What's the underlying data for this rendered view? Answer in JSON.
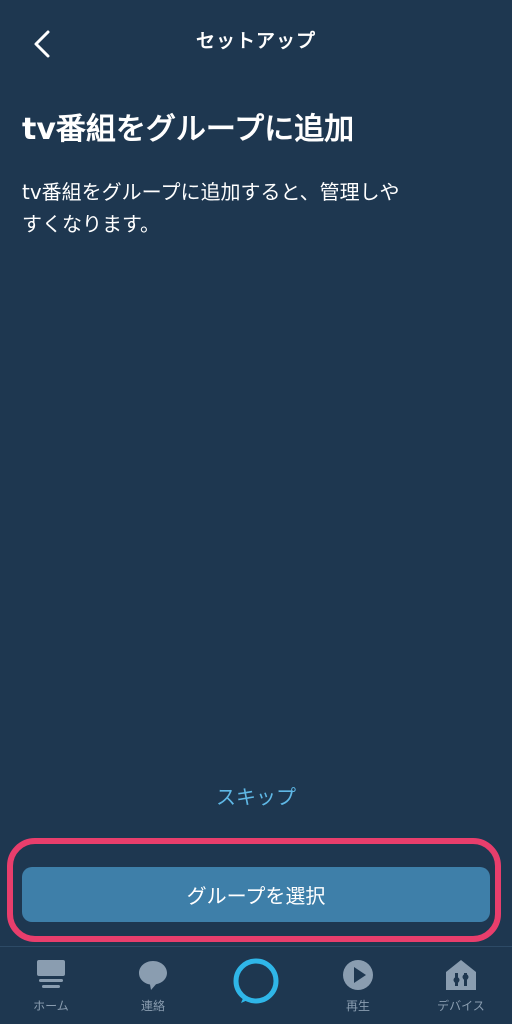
{
  "header": {
    "title": "セットアップ",
    "back_icon": "chevron-left-icon"
  },
  "main": {
    "title": "tv番組をグループに追加",
    "description_line1": "tv番組をグループに追加すると、管理しや",
    "description_line2": "すくなります。"
  },
  "actions": {
    "skip_label": "スキップ",
    "primary_label": "グループを選択",
    "highlight_color": "#e83e6c",
    "primary_color": "#3e7fa9",
    "link_color": "#5fb8e6"
  },
  "tab_bar": {
    "items": [
      {
        "label": "ホーム",
        "icon": "home-icon"
      },
      {
        "label": "連絡",
        "icon": "chat-bubble-icon"
      },
      {
        "label": "",
        "icon": "alexa-ring-icon"
      },
      {
        "label": "再生",
        "icon": "play-icon"
      },
      {
        "label": "デバイス",
        "icon": "devices-icon"
      }
    ]
  },
  "colors": {
    "background": "#1e3750",
    "text": "#ffffff",
    "tab_inactive": "#8a9db0",
    "alexa_accent": "#2fb6e8"
  }
}
